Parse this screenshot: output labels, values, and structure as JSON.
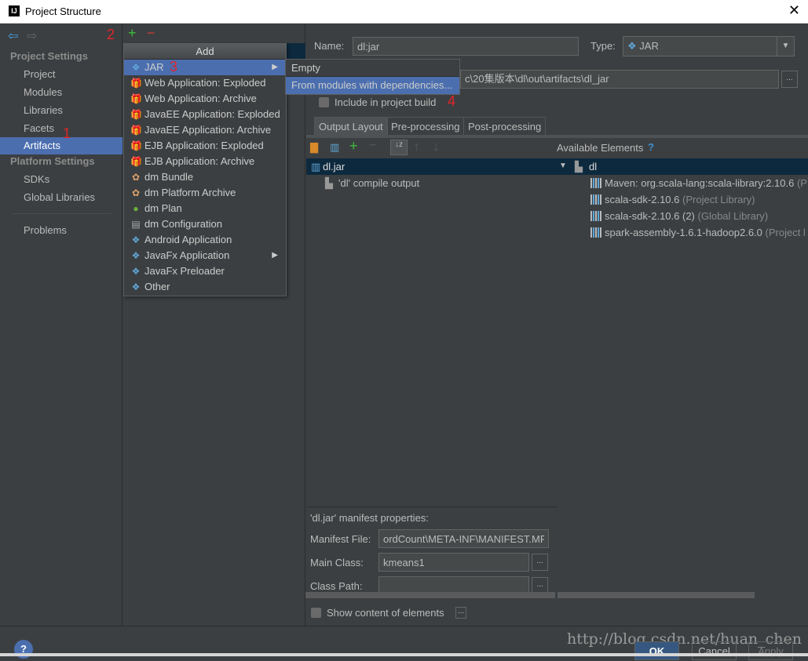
{
  "window": {
    "title": "Project Structure",
    "logo": "IJ"
  },
  "left": {
    "project_settings": "Project Settings",
    "items": [
      "Project",
      "Modules",
      "Libraries",
      "Facets",
      "Artifacts"
    ],
    "platform_settings": "Platform Settings",
    "platform_items": [
      "SDKs",
      "Global Libraries"
    ],
    "problems": "Problems"
  },
  "annotations": {
    "a1": "1",
    "a2": "2",
    "a3": "3",
    "a4": "4"
  },
  "menu": {
    "title": "Add",
    "items": [
      {
        "label": "JAR",
        "icon": "jar-diamond-icon",
        "submenu": true
      },
      {
        "label": "Web Application: Exploded",
        "icon": "web-app-icon"
      },
      {
        "label": "Web Application: Archive",
        "icon": "web-app-icon"
      },
      {
        "label": "JavaEE Application: Exploded",
        "icon": "javaee-icon"
      },
      {
        "label": "JavaEE Application: Archive",
        "icon": "javaee-icon"
      },
      {
        "label": "EJB Application: Exploded",
        "icon": "ejb-icon"
      },
      {
        "label": "EJB Application: Archive",
        "icon": "ejb-icon"
      },
      {
        "label": "dm Bundle",
        "icon": "dm-bundle-icon"
      },
      {
        "label": "dm Platform Archive",
        "icon": "dm-platform-icon"
      },
      {
        "label": "dm Plan",
        "icon": "dm-plan-icon"
      },
      {
        "label": "dm Configuration",
        "icon": "file-icon"
      },
      {
        "label": "Android Application",
        "icon": "diamond-icon"
      },
      {
        "label": "JavaFx Application",
        "icon": "diamond-icon",
        "submenu": true
      },
      {
        "label": "JavaFx Preloader",
        "icon": "diamond-icon"
      },
      {
        "label": "Other",
        "icon": "diamond-icon"
      }
    ]
  },
  "submenu": {
    "items": [
      "Empty",
      "From modules with dependencies..."
    ]
  },
  "form": {
    "name_label": "Name:",
    "name_value": "dl:jar",
    "type_label": "Type:",
    "type_value": "JAR",
    "output_path": "c\\20集版本\\dl\\out\\artifacts\\dl_jar",
    "include_label": "Include in project build"
  },
  "tabs": [
    "Output Layout",
    "Pre-processing",
    "Post-processing"
  ],
  "layout": {
    "root": "dl.jar",
    "child": "'dl' compile output",
    "available_label": "Available Elements",
    "help": "?",
    "module": "dl",
    "libs": [
      {
        "name": "Maven: org.scala-lang:scala-library:2.10.6",
        "note": "(P"
      },
      {
        "name": "scala-sdk-2.10.6",
        "note": "(Project Library)"
      },
      {
        "name": "scala-sdk-2.10.6 (2)",
        "note": "(Global Library)"
      },
      {
        "name": "spark-assembly-1.6.1-hadoop2.6.0",
        "note": "(Project l"
      }
    ]
  },
  "manifest": {
    "title": "'dl.jar' manifest properties:",
    "file_label": "Manifest File:",
    "file_value": "ordCount\\META-INF\\MANIFEST.MF",
    "main_label": "Main Class:",
    "main_value": "kmeans1",
    "path_label": "Class Path:",
    "path_value": ""
  },
  "show_content": "Show content of elements",
  "buttons": {
    "ok": "OK",
    "cancel": "Cancel",
    "apply": "Apply",
    "help": "?",
    "browse": "..."
  },
  "watermark": "http://blog.csdn.net/huan_chen"
}
